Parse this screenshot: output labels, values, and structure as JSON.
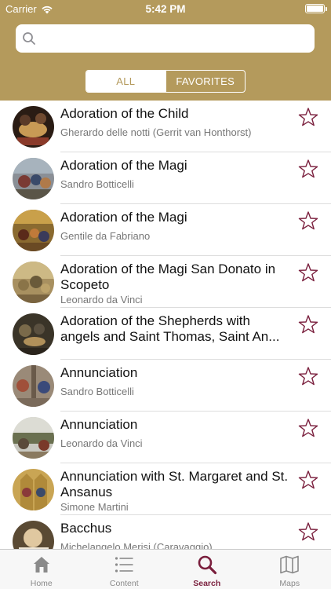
{
  "status_bar": {
    "carrier": "Carrier",
    "time": "5:42 PM"
  },
  "search": {
    "placeholder": "",
    "value": ""
  },
  "segments": {
    "all": "ALL",
    "favorites": "FAVORITES",
    "selected": "all"
  },
  "items": [
    {
      "title": "Adoration of the Child",
      "subtitle": "Gherardo delle notti (Gerrit van Honthorst)",
      "favorite": false,
      "thumb_color": "#3a2a1f"
    },
    {
      "title": "Adoration of the Magi",
      "subtitle": "Sandro Botticelli",
      "favorite": false,
      "thumb_color": "#6b6f7a"
    },
    {
      "title": "Adoration of the Magi",
      "subtitle": "Gentile da Fabriano",
      "favorite": false,
      "thumb_color": "#9c7a3c"
    },
    {
      "title": "Adoration of the Magi San Donato in Scopeto",
      "subtitle": "Leonardo da Vinci",
      "favorite": false,
      "thumb_color": "#b39c63"
    },
    {
      "title_line1": "Adoration of the Shepherds with",
      "title_line2": "angels and Saint Thomas, Saint An...",
      "subtitle": "",
      "favorite": false,
      "thumb_color": "#4a4438"
    },
    {
      "title": "Annunciation",
      "subtitle": "Sandro Botticelli",
      "favorite": false,
      "thumb_color": "#8a6a5a"
    },
    {
      "title": "Annunciation",
      "subtitle": "Leonardo da Vinci",
      "favorite": false,
      "thumb_color": "#7a7a6a"
    },
    {
      "title": "Annunciation with St. Margaret and St. Ansanus",
      "subtitle": "Simone Martini",
      "favorite": false,
      "thumb_color": "#c9a554"
    },
    {
      "title": "Bacchus",
      "subtitle": "Michelangelo Merisi (Caravaggio)",
      "favorite": false,
      "thumb_color": "#d9c6a0"
    }
  ],
  "tabs": [
    {
      "label": "Home",
      "icon": "home-icon",
      "active": false
    },
    {
      "label": "Content",
      "icon": "list-icon",
      "active": false
    },
    {
      "label": "Search",
      "icon": "search-icon",
      "active": true
    },
    {
      "label": "Maps",
      "icon": "map-icon",
      "active": false
    }
  ],
  "colors": {
    "header": "#b49a5c",
    "accent": "#7a1f3d",
    "divider": "#dddddd"
  }
}
